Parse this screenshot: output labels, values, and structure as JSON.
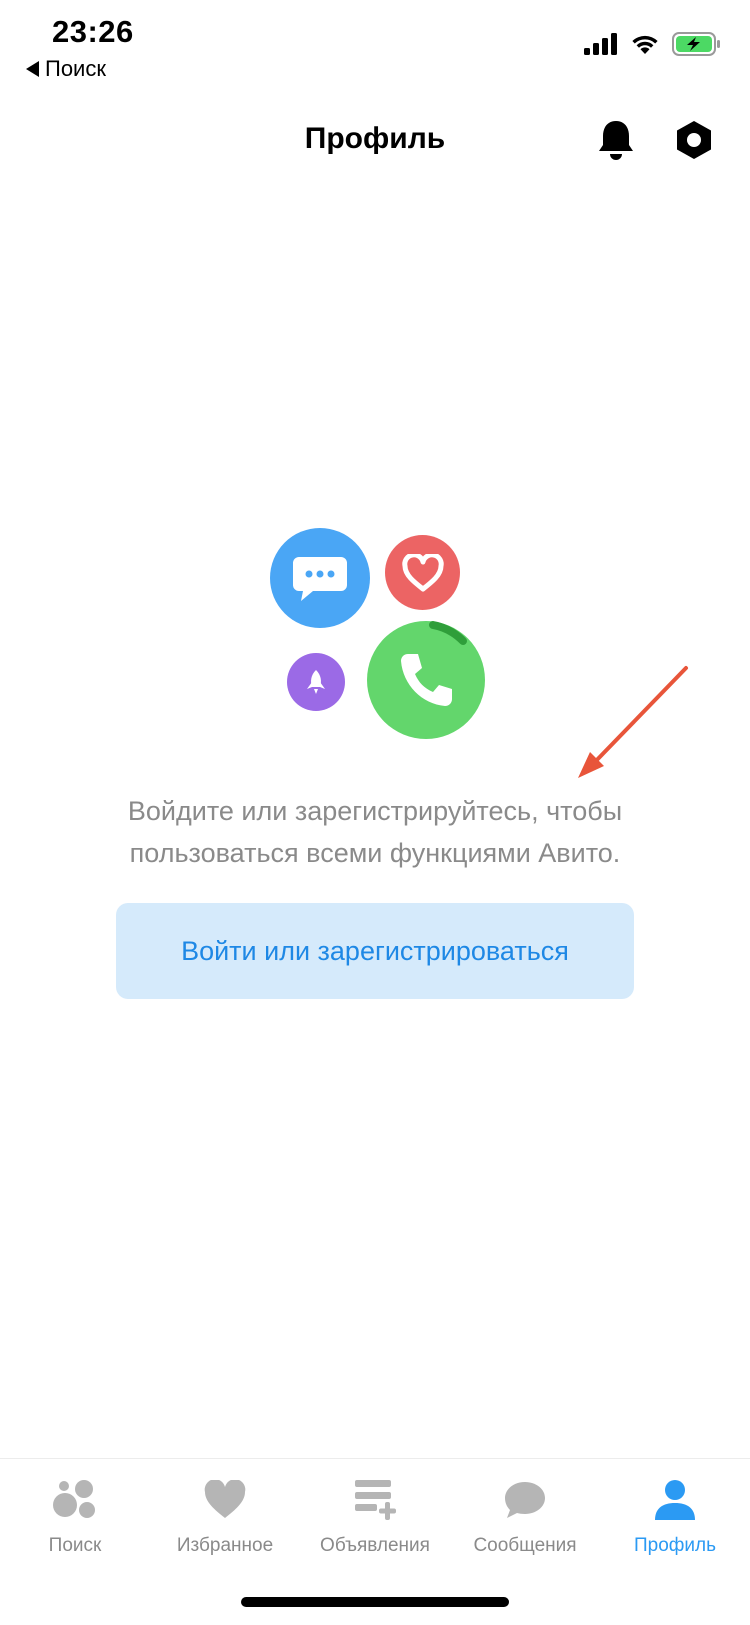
{
  "status_bar": {
    "time": "23:26",
    "back_label": "Поиск",
    "icons": [
      "cellular-signal-icon",
      "wifi-icon",
      "battery-charging-icon"
    ],
    "battery_color": "#4cd964"
  },
  "header": {
    "title": "Профиль",
    "icons": [
      "bell-icon",
      "settings-icon"
    ]
  },
  "main": {
    "illustration_icons": [
      "chat-bubble-icon",
      "heart-icon",
      "rocket-icon",
      "phone-icon"
    ],
    "info_text": "Войдите или зарегистрируйтесь, чтобы пользоваться всеми функциями Авито.",
    "login_button_label": "Войти или зарегистрироваться"
  },
  "tab_bar": {
    "tabs": [
      {
        "label": "Поиск",
        "icon": "search-dots-icon",
        "active": false
      },
      {
        "label": "Избранное",
        "icon": "heart-icon",
        "active": false
      },
      {
        "label": "Объявления",
        "icon": "add-listing-icon",
        "active": false
      },
      {
        "label": "Сообщения",
        "icon": "message-bubble-icon",
        "active": false
      },
      {
        "label": "Профиль",
        "icon": "user-icon",
        "active": true
      }
    ]
  },
  "colors": {
    "accent": "#2b9af3",
    "button_bg": "#d5eafb",
    "button_text": "#1e88e5",
    "inactive": "#b5b5b5",
    "annotation_arrow": "#e8553a"
  }
}
